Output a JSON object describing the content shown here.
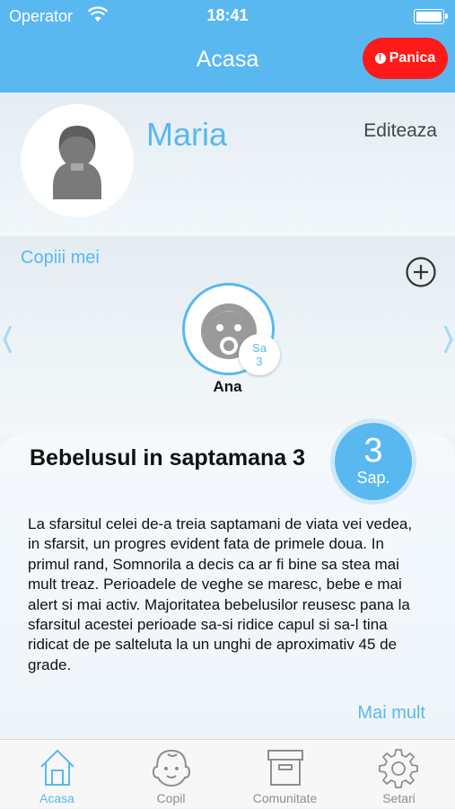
{
  "status_bar": {
    "carrier": "Operator",
    "time": "18:41"
  },
  "nav": {
    "title": "Acasa",
    "panic_label": "Panica"
  },
  "profile": {
    "name": "Maria",
    "edit_label": "Editeaza"
  },
  "children": {
    "title": "Copiii mei",
    "items": [
      {
        "name": "Ana",
        "badge_line1": "Sa",
        "badge_line2": "3"
      }
    ]
  },
  "week_card": {
    "title": "Bebelusul in saptamana 3",
    "week_number": "3",
    "week_unit": "Sap.",
    "body": "La sfarsitul celei de-a treia saptamani de viata vei vedea, in sfarsit, un progres evident fata de primele doua. In primul rand, Somnorila a decis ca ar fi bine sa stea mai mult treaz. Perioadele de veghe se maresc, bebe e mai alert si mai activ. Majoritatea bebelusilor reusesc pana la sfarsitul acestei perioade sa-si ridice capul si sa-l tina ridicat de pe salteluta la un unghi de aproximativ 45 de grade.",
    "more_label": "Mai mult"
  },
  "tabs": [
    {
      "label": "Acasa",
      "icon": "home-icon",
      "active": true
    },
    {
      "label": "Copil",
      "icon": "baby-face-icon",
      "active": false
    },
    {
      "label": "Comunitate",
      "icon": "archive-box-icon",
      "active": false
    },
    {
      "label": "Setari",
      "icon": "gear-icon",
      "active": false
    }
  ],
  "colors": {
    "accent": "#5ab8f0",
    "panic": "#ff1a1a",
    "tab_inactive": "#8e8e8e"
  }
}
